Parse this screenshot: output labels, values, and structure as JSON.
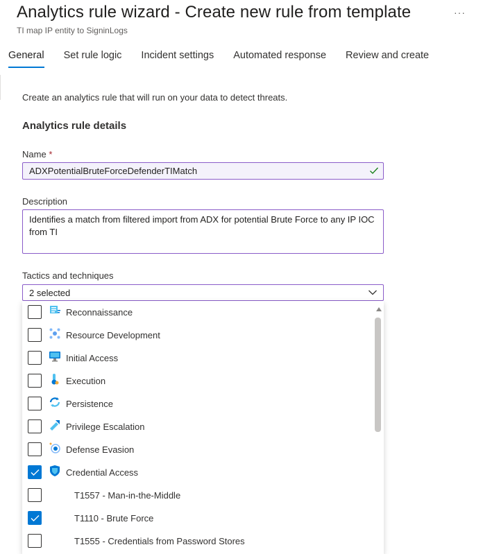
{
  "header": {
    "title": "Analytics rule wizard - Create new rule from template",
    "subtitle": "TI map IP entity to SigninLogs",
    "more_label": "···"
  },
  "tabs": [
    {
      "label": "General",
      "active": true
    },
    {
      "label": "Set rule logic",
      "active": false
    },
    {
      "label": "Incident settings",
      "active": false
    },
    {
      "label": "Automated response",
      "active": false
    },
    {
      "label": "Review and create",
      "active": false
    }
  ],
  "form": {
    "intro": "Create an analytics rule that will run on your data to detect threats.",
    "section_title": "Analytics rule details",
    "name_label": "Name",
    "required_marker": "*",
    "name_value": "ADXPotentialBruteForceDefenderTIMatch",
    "description_label": "Description",
    "description_value": "Identifies a match from filtered import from ADX for potential Brute Force to any IP IOC from TI",
    "tactics_label": "Tactics and techniques",
    "tactics_selected": "2 selected"
  },
  "tactics_options": [
    {
      "label": "Reconnaissance",
      "checked": false,
      "icon": "reconnaissance-icon"
    },
    {
      "label": "Resource Development",
      "checked": false,
      "icon": "resource-development-icon"
    },
    {
      "label": "Initial Access",
      "checked": false,
      "icon": "initial-access-icon"
    },
    {
      "label": "Execution",
      "checked": false,
      "icon": "execution-icon"
    },
    {
      "label": "Persistence",
      "checked": false,
      "icon": "persistence-icon"
    },
    {
      "label": "Privilege Escalation",
      "checked": false,
      "icon": "privilege-escalation-icon"
    },
    {
      "label": "Defense Evasion",
      "checked": false,
      "icon": "defense-evasion-icon"
    },
    {
      "label": "Credential Access",
      "checked": true,
      "icon": "credential-access-icon"
    },
    {
      "label": "T1557 - Man-in-the-Middle",
      "checked": false,
      "sub": true
    },
    {
      "label": "T1110 - Brute Force",
      "checked": true,
      "sub": true
    },
    {
      "label": "T1555 - Credentials from Password Stores",
      "checked": false,
      "sub": true
    }
  ],
  "colors": {
    "accent": "#0078d4",
    "focus_border": "#8a5cc9",
    "valid_check": "#107c10"
  }
}
